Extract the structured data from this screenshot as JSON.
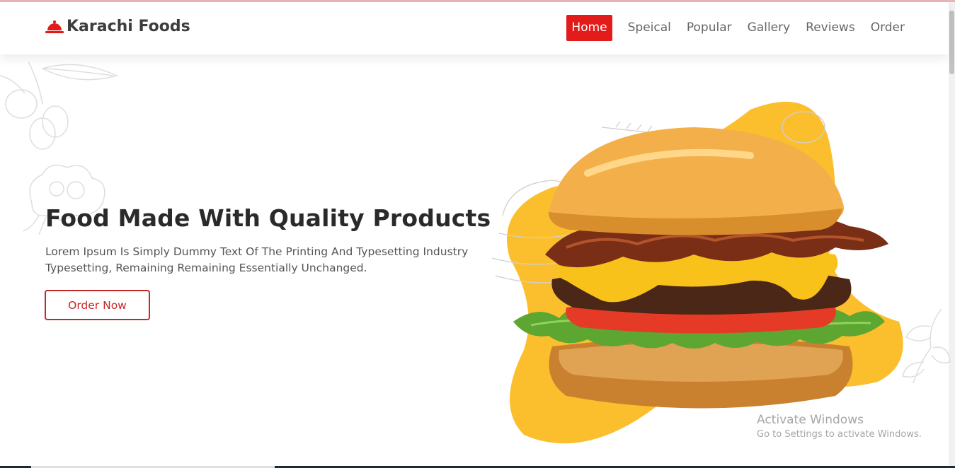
{
  "brand": {
    "name": "Karachi Foods",
    "icon": "cloche-icon",
    "accent": "#e21b1b"
  },
  "nav": {
    "items": [
      {
        "label": "Home",
        "active": true
      },
      {
        "label": "Speical",
        "active": false
      },
      {
        "label": "Popular",
        "active": false
      },
      {
        "label": "Gallery",
        "active": false
      },
      {
        "label": "Reviews",
        "active": false
      },
      {
        "label": "Order",
        "active": false
      }
    ]
  },
  "hero": {
    "title": "Food Made With Quality Products",
    "description": "Lorem Ipsum Is Simply Dummy Text Of The Printing And Typesetting Industry Typesetting, Remaining Remaining Essentially Unchanged.",
    "cta_label": "Order Now",
    "image": "burger-image",
    "blob_color": "#fbbf2e"
  },
  "watermark": {
    "title": "Activate Windows",
    "subtitle": "Go to Settings to activate Windows."
  }
}
